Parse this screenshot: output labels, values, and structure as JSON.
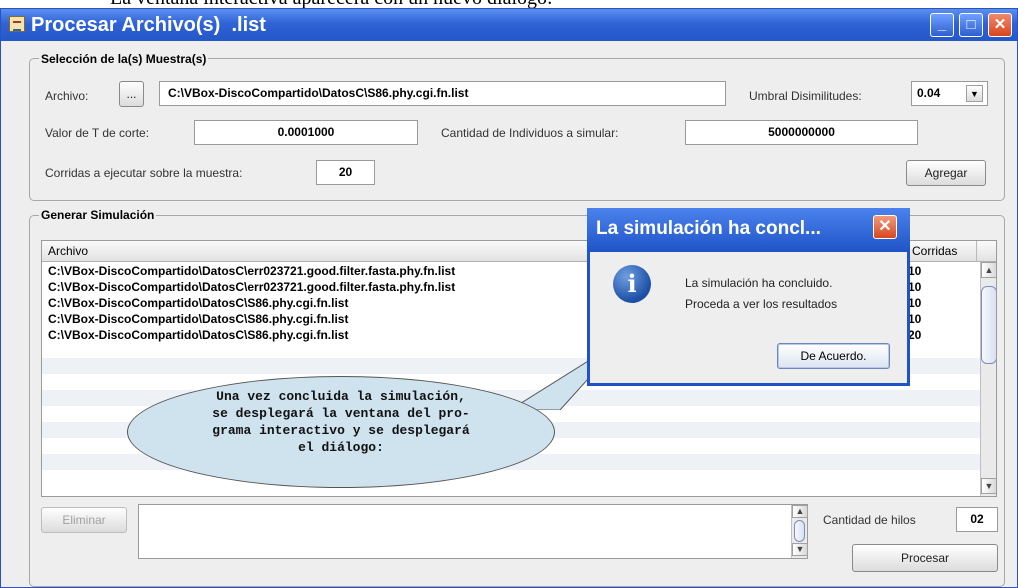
{
  "caption_cutoff": "La ventana interactiva aparecerá con un nuevo diálogo:",
  "window": {
    "title": "Procesar Archivo(s)  .list"
  },
  "seleccion": {
    "title": "Selección de la(s) Muestra(s)",
    "archivo_label": "Archivo:",
    "browse_label": "...",
    "archivo_value": "C:\\VBox-DiscoCompartido\\DatosC\\S86.phy.cgi.fn.list",
    "umbral_label": "Umbral Disimilitudes:",
    "umbral_value": "0.04",
    "valor_t_label": "Valor de T de corte:",
    "valor_t_value": "0.0001000",
    "cantidad_label": "Cantidad de Individuos a simular:",
    "cantidad_value": "5000000000",
    "corridas_label": "Corridas a ejecutar sobre la muestra:",
    "corridas_value": "20",
    "agregar_label": "Agregar"
  },
  "generar": {
    "title": "Generar Simulación",
    "columns": [
      "Archivo",
      "Corridas"
    ],
    "rows": [
      {
        "archivo": "C:\\VBox-DiscoCompartido\\DatosC\\err023721.good.filter.fasta.phy.fn.list",
        "corridas": "10"
      },
      {
        "archivo": "C:\\VBox-DiscoCompartido\\DatosC\\err023721.good.filter.fasta.phy.fn.list",
        "corridas": "10"
      },
      {
        "archivo": "C:\\VBox-DiscoCompartido\\DatosC\\S86.phy.cgi.fn.list",
        "corridas": "10"
      },
      {
        "archivo": "C:\\VBox-DiscoCompartido\\DatosC\\S86.phy.cgi.fn.list",
        "corridas": "10"
      },
      {
        "archivo": "C:\\VBox-DiscoCompartido\\DatosC\\S86.phy.cgi.fn.list",
        "corridas": "20"
      }
    ],
    "eliminar_label": "Eliminar",
    "hilos_label": "Cantidad de hilos",
    "hilos_value": "02",
    "procesar_label": "Procesar"
  },
  "balloon": {
    "lines": [
      "Una vez concluida la simulación,",
      "se desplegará la ventana del pro-",
      "grama interactivo y se desplegará",
      "el diálogo:"
    ]
  },
  "dialog": {
    "title": "La simulación ha concl...",
    "message_1": "La simulación ha concluido.",
    "message_2": "Proceda a ver los resultados",
    "ok_label": "De Acuerdo."
  },
  "colors": {
    "titlebar": "#2f63d6",
    "dialog_border": "#1f54c8",
    "close_button": "#d8461e",
    "balloon_fill": "#cfe3ef",
    "window_background": "#eeeeee"
  },
  "icons": [
    "app-icon",
    "minimize-icon",
    "maximize-icon",
    "close-icon",
    "dropdown-arrow-icon",
    "info-icon",
    "scroll-up-icon",
    "scroll-down-icon"
  ]
}
